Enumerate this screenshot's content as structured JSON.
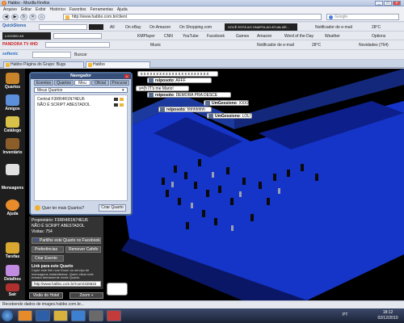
{
  "window": {
    "title": "Habbo - Mozilla Firefox",
    "min": "_",
    "max": "□",
    "close": "×"
  },
  "menu": [
    "Arquivo",
    "Editar",
    "Exibir",
    "Histórico",
    "Favoritos",
    "Ferramentas",
    "Ajuda"
  ],
  "nav": {
    "back": "◀",
    "forward": "▶",
    "reload": "↻",
    "stop": "✕",
    "home": "⌂",
    "url": "http://www.habbo.com.br/client",
    "search_placeholder": "Google"
  },
  "toolbar1": {
    "quickstores": "QuickStores",
    "all": "All",
    "onebay": "On eBay",
    "onamazon": "On Amazon",
    "onshopping": "On Shopping.com",
    "ticker": "VOCÊ ESTÁ AO ONAPOLAO ATUALIZE...",
    "notifier": "Notificador de e-mail",
    "weather": "28°C"
  },
  "toolbar2": {
    "brand": "LOGGED AS",
    "kmplayer": "KMPlayer",
    "cnn": "CNN",
    "youtube": "YouTube",
    "facebook": "Facebook",
    "games": "Games",
    "amazon": "Amazon",
    "word": "Word of the Day",
    "weatherlink": "Weather",
    "options": "Options"
  },
  "toolbar3": {
    "pandora": "PANDORA TV 4HD",
    "music": "Music",
    "notifier": "Notificador de e-mail",
    "weather": "28°C",
    "news": "Novidades (764)"
  },
  "toolbar4": {
    "softonic": "softonic",
    "buscar": "Buscar",
    "novidades": "Novidades (764)"
  },
  "tabs": [
    {
      "label": "Habbo Página do Grupo: Bugs"
    },
    {
      "label": "Habbo"
    }
  ],
  "leftbar": [
    {
      "label": "Quartos"
    },
    {
      "label": "Amigos"
    },
    {
      "label": "Catálogo"
    },
    {
      "label": "Inventário"
    },
    {
      "label": "Mensagens"
    },
    {
      "label": "Ajuda"
    },
    {
      "label": "Tarefas"
    },
    {
      "label": "Detalhes"
    },
    {
      "label": "Sair"
    }
  ],
  "navigator": {
    "title": "Navegador",
    "close": "x",
    "tabs": [
      "Eventos",
      "Quartos",
      "Meu",
      "Oficial",
      "Procurar"
    ],
    "active_tab": "Meu",
    "select": "Meus Quartos",
    "rooms": [
      "Central F3RR4R1N74EU6",
      "NÃO É SCRIPT ABESTADOL"
    ],
    "want_more": "Quer ter mais Quartos?",
    "create": "Criar Quarto"
  },
  "roominfo": {
    "owner": "Proprietário: F3RR4R1N74EU6",
    "name": "NÃO É SCRIPT ABESTADOL",
    "visitors": "Visitas: 754",
    "share_fb": "Partilhe este Quarto no Facebook",
    "prefs": "Preferências",
    "remove": "Remover Cafofo",
    "create_event": "Criar Evento",
    "link_title": "Link para este Quarto",
    "link_desc": "Copie este link num fórum ou serviço de mensagens instantâneas. Quem clicar nele entrará diretamente neste Quarto.",
    "link": "http://www.habbo.com.br/room/426622",
    "view_hotel": "Visão do Hotel",
    "zoom": "Zoom +"
  },
  "chat": [
    {
      "user": "reiposoto",
      "text": "AFFF"
    },
    {
      "user": "",
      "text": "s=(h IT's me Mario!"
    },
    {
      "user": "reiposoto",
      "text": "DEMORA PRA DESCE"
    },
    {
      "user": "UmGessiono",
      "text": "XXXXX"
    },
    {
      "user": "reiposoto",
      "text": "hhhhhhhh"
    },
    {
      "user": "UmGessiono",
      "text": "LOL!"
    },
    {
      "user": "",
      "text": "x x x x x x x x x x x x x x x x x x x x x x"
    }
  ],
  "status": "Recebendo dados de images.habbo.com.br...",
  "taskbar": {
    "lang": "PT",
    "time": "18:12",
    "date": "02/12/2010"
  }
}
